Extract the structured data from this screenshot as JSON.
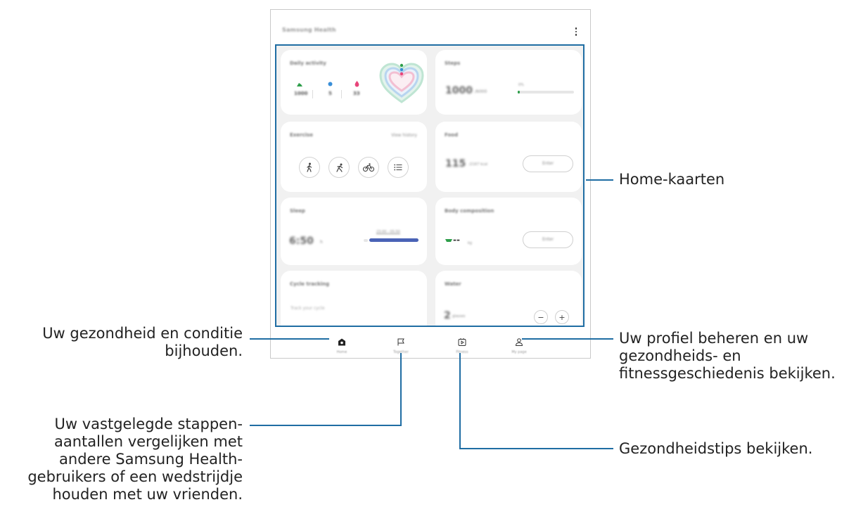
{
  "app": {
    "title": "Samsung Health"
  },
  "cards": {
    "daily_activity": {
      "title": "Daily activity",
      "steps": "1000",
      "minutes": "5",
      "calories": "33"
    },
    "steps": {
      "title": "Steps",
      "value": "1000",
      "unit": "/6000",
      "percent_label": "0%",
      "progress": 0.02
    },
    "exercise": {
      "title": "Exercise",
      "link": "View history"
    },
    "food": {
      "title": "Food",
      "value": "115",
      "unit": "/2167 kcal",
      "button": "Enter"
    },
    "sleep": {
      "title": "Sleep",
      "value": "6:50",
      "unit": "h",
      "range": "23:00 - 05:50"
    },
    "body_composition": {
      "title": "Body composition",
      "value": "--",
      "unit": "kg",
      "button": "Enter"
    },
    "cycle_tracking": {
      "title": "Cycle tracking",
      "subtitle": "Track your cycle"
    },
    "water": {
      "title": "Water",
      "value": "2",
      "unit": "glasses",
      "minus": "−",
      "plus": "+"
    }
  },
  "nav": [
    {
      "label": "Home",
      "icon": "home-icon"
    },
    {
      "label": "Together",
      "icon": "flag-icon"
    },
    {
      "label": "Fitness",
      "icon": "fitness-icon"
    },
    {
      "label": "My page",
      "icon": "person-icon"
    }
  ],
  "annotations": {
    "home_cards": "Home-kaarten",
    "home_tab": [
      "Uw gezondheid en conditie",
      "bijhouden."
    ],
    "together_tab": [
      "Uw vastgelegde stappen-",
      "aantallen vergelijken met",
      "andere Samsung Health-",
      "gebruikers of een wedstrijdje",
      "houden met uw vrienden."
    ],
    "my_page_tab": [
      "Uw profiel beheren en uw",
      "gezondheids- en",
      "fitnessgeschiedenis bekijken."
    ],
    "fitness_tab": "Gezondheidstips bekijken."
  },
  "colors": {
    "accent_line": "#1f6da3",
    "steps_green": "#2e9e4a",
    "minutes_blue": "#3a8fd8",
    "calories_pink": "#e8457a",
    "sleep_bar": "#4a63b6"
  }
}
